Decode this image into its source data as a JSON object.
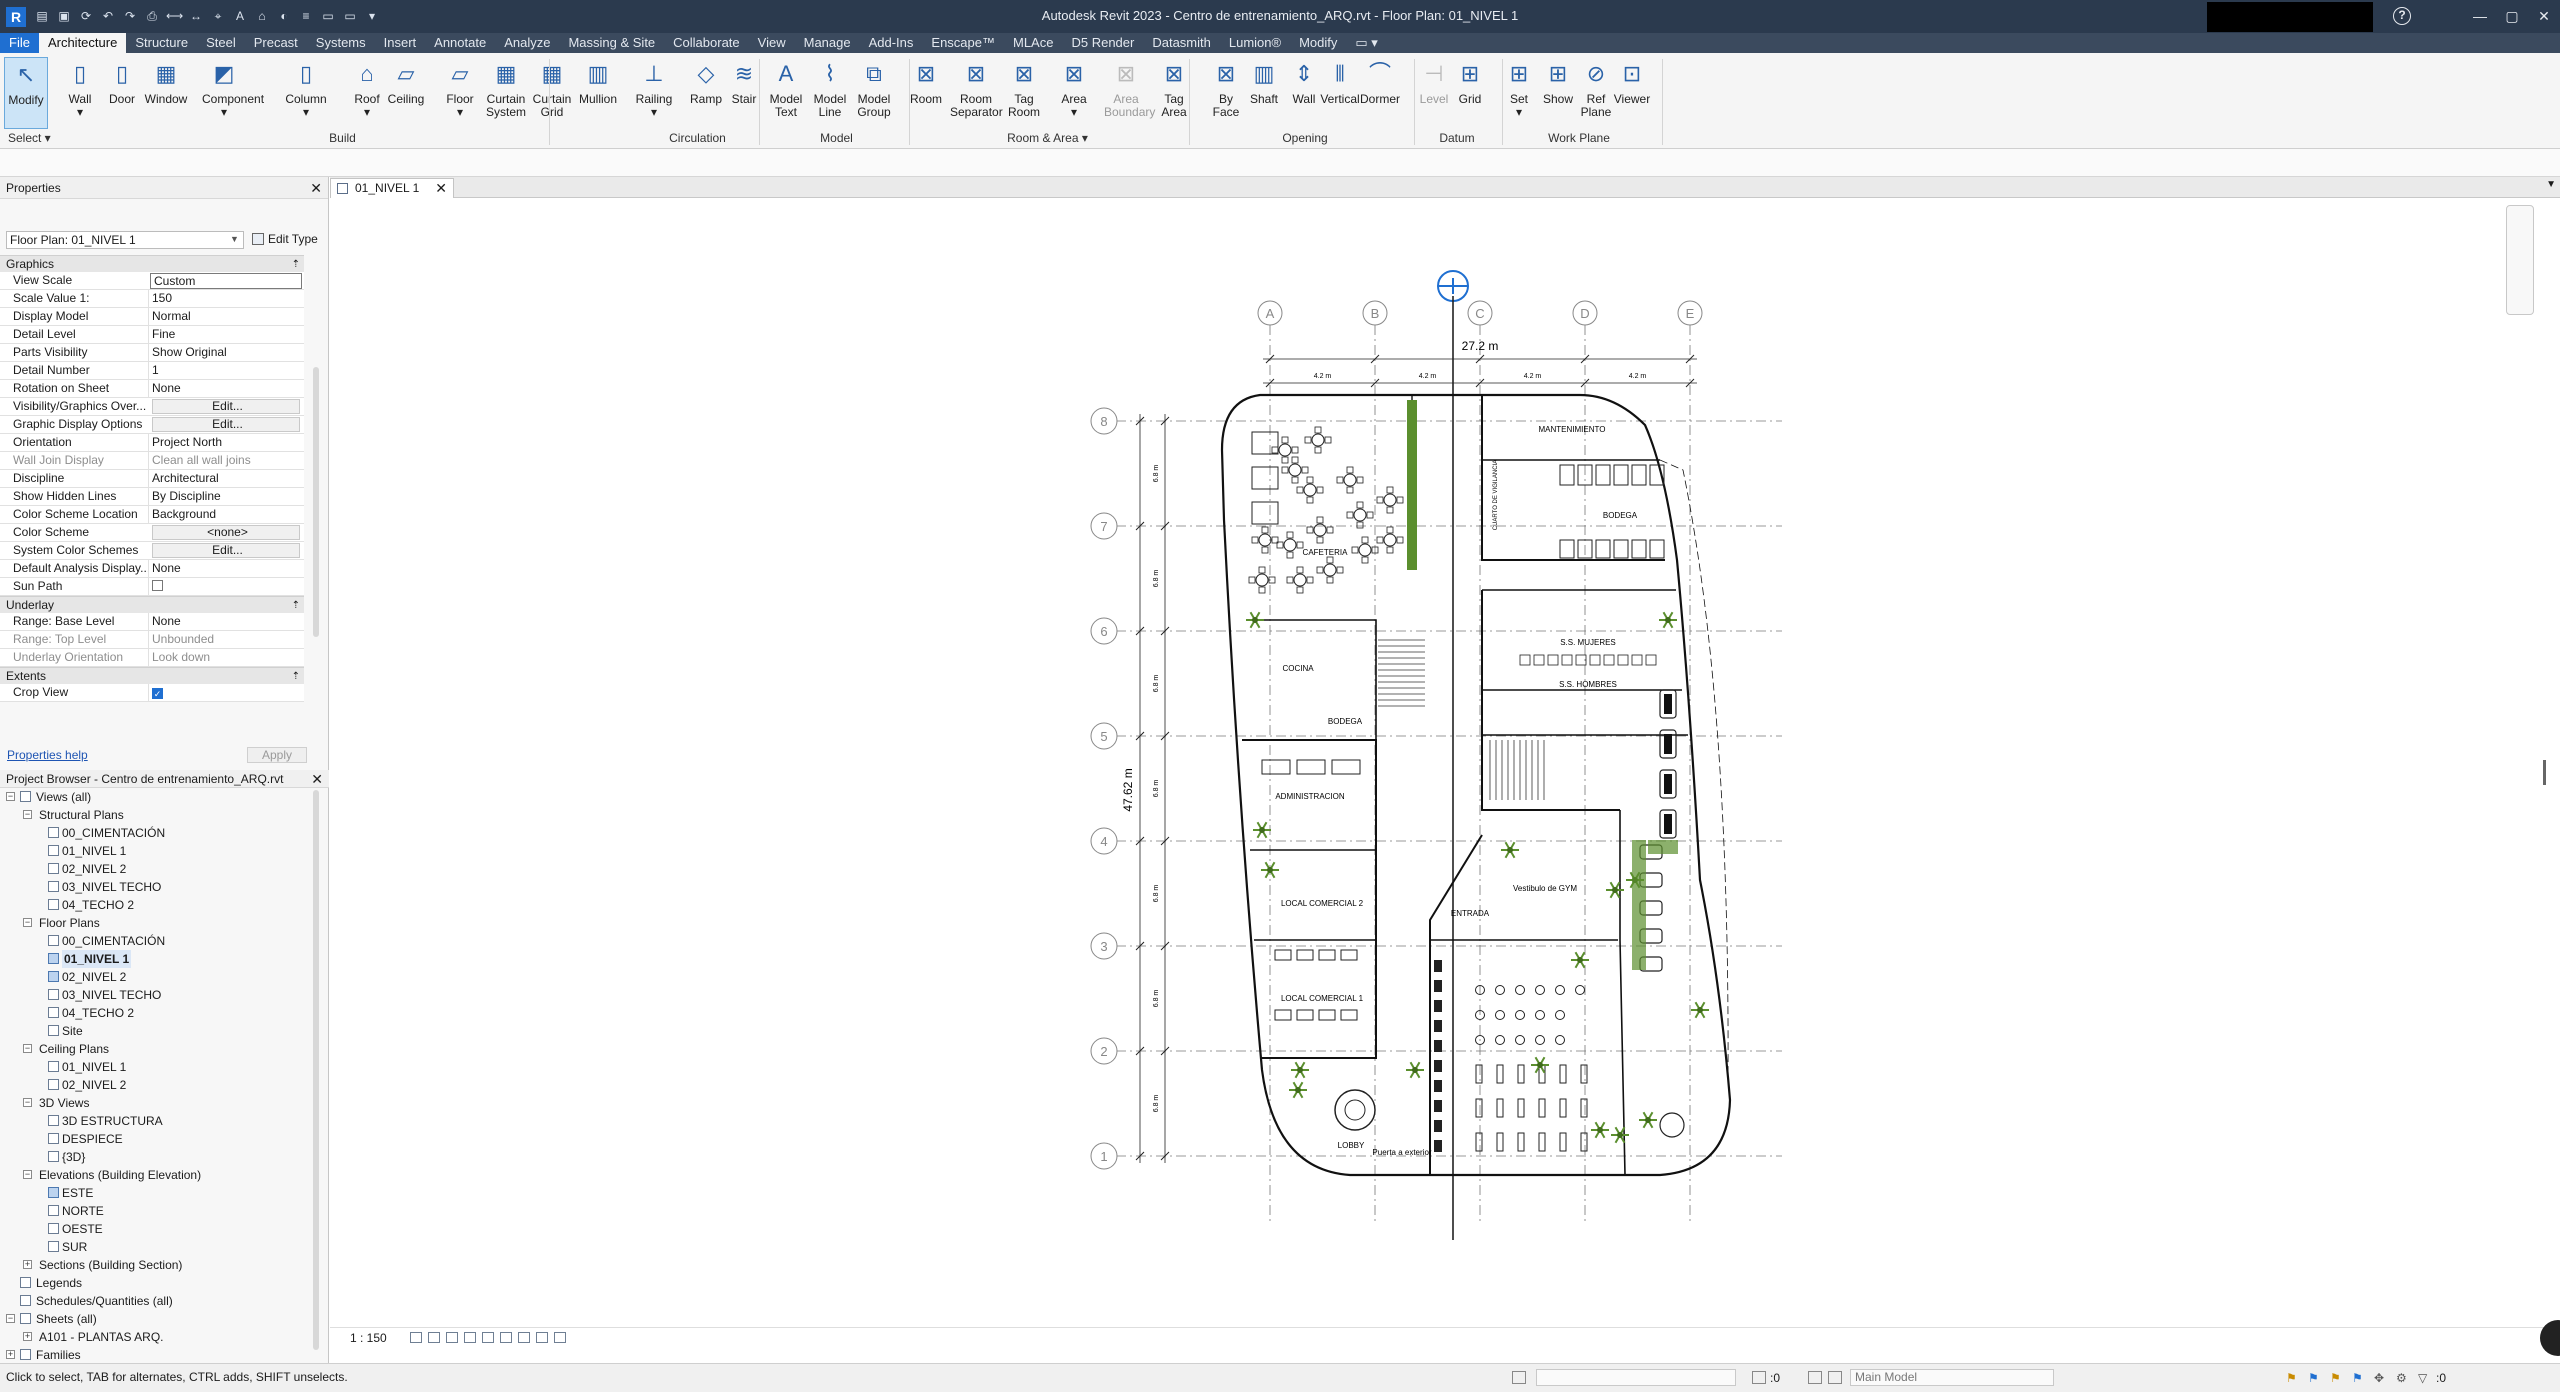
{
  "window": {
    "title": "Autodesk Revit 2023 - Centro de entrenamiento_ARQ.rvt - Floor Plan: 01_NIVEL 1",
    "app_icon": "R",
    "help": "?",
    "min": "—",
    "max": "▢",
    "close": "✕"
  },
  "tabs": [
    {
      "label": "File"
    },
    {
      "label": "Architecture"
    },
    {
      "label": "Structure"
    },
    {
      "label": "Steel"
    },
    {
      "label": "Precast"
    },
    {
      "label": "Systems"
    },
    {
      "label": "Insert"
    },
    {
      "label": "Annotate"
    },
    {
      "label": "Analyze"
    },
    {
      "label": "Massing & Site"
    },
    {
      "label": "Collaborate"
    },
    {
      "label": "View"
    },
    {
      "label": "Manage"
    },
    {
      "label": "Add-Ins"
    },
    {
      "label": "Enscape™"
    },
    {
      "label": "MLAce"
    },
    {
      "label": "D5 Render"
    },
    {
      "label": "Datasmith"
    },
    {
      "label": "Lumion®"
    },
    {
      "label": "Modify"
    },
    {
      "label": "▭ ▾"
    }
  ],
  "ribbon": {
    "select_label": "Select ▾",
    "panels": [
      "Build",
      "Circulation",
      "Model",
      "Room & Area ▾",
      "Opening",
      "Datum",
      "Work Plane"
    ],
    "buttons": [
      {
        "l1": "Modify",
        "l2": ""
      },
      {
        "l1": "Wall",
        "l2": "▾"
      },
      {
        "l1": "Door",
        "l2": ""
      },
      {
        "l1": "Window",
        "l2": ""
      },
      {
        "l1": "Component",
        "l2": "▾"
      },
      {
        "l1": "Column",
        "l2": "▾"
      },
      {
        "l1": "Roof",
        "l2": "▾"
      },
      {
        "l1": "Ceiling",
        "l2": ""
      },
      {
        "l1": "Floor",
        "l2": "▾"
      },
      {
        "l1": "Curtain",
        "l2": "System"
      },
      {
        "l1": "Curtain",
        "l2": "Grid"
      },
      {
        "l1": "Mullion",
        "l2": ""
      },
      {
        "l1": "Railing",
        "l2": "▾"
      },
      {
        "l1": "Ramp",
        "l2": ""
      },
      {
        "l1": "Stair",
        "l2": ""
      },
      {
        "l1": "Model",
        "l2": "Text"
      },
      {
        "l1": "Model",
        "l2": "Line"
      },
      {
        "l1": "Model",
        "l2": "Group"
      },
      {
        "l1": "Room",
        "l2": ""
      },
      {
        "l1": "Room",
        "l2": "Separator"
      },
      {
        "l1": "Tag",
        "l2": "Room"
      },
      {
        "l1": "Area",
        "l2": "▾"
      },
      {
        "l1": "Area",
        "l2": "Boundary"
      },
      {
        "l1": "Tag",
        "l2": "Area"
      },
      {
        "l1": "By",
        "l2": "Face"
      },
      {
        "l1": "Shaft",
        "l2": ""
      },
      {
        "l1": "Wall",
        "l2": ""
      },
      {
        "l1": "Vertical",
        "l2": ""
      },
      {
        "l1": "Dormer",
        "l2": ""
      },
      {
        "l1": "Level",
        "l2": ""
      },
      {
        "l1": "Grid",
        "l2": ""
      },
      {
        "l1": "Set",
        "l2": "▾"
      },
      {
        "l1": "Show",
        "l2": ""
      },
      {
        "l1": "Ref",
        "l2": "Plane"
      },
      {
        "l1": "Viewer",
        "l2": ""
      }
    ]
  },
  "properties": {
    "title": "Properties",
    "close": "✕",
    "type_selector": "Floor Plan: 01_NIVEL 1",
    "edit_type": "Edit Type",
    "groups": [
      {
        "name": "Graphics",
        "rows": [
          [
            "View Scale",
            "Custom"
          ],
          [
            "Scale Value    1:",
            "150"
          ],
          [
            "Display Model",
            "Normal"
          ],
          [
            "Detail Level",
            "Fine"
          ],
          [
            "Parts Visibility",
            "Show Original"
          ],
          [
            "Detail Number",
            "1"
          ],
          [
            "Rotation on Sheet",
            "None"
          ],
          [
            "Visibility/Graphics Over...",
            "Edit..."
          ],
          [
            "Graphic Display Options",
            "Edit..."
          ],
          [
            "Orientation",
            "Project North"
          ],
          [
            "Wall Join Display",
            "Clean all wall joins"
          ],
          [
            "Discipline",
            "Architectural"
          ],
          [
            "Show Hidden Lines",
            "By Discipline"
          ],
          [
            "Color Scheme Location",
            "Background"
          ],
          [
            "Color Scheme",
            "<none>"
          ],
          [
            "System Color Schemes",
            "Edit..."
          ],
          [
            "Default Analysis Display...",
            "None"
          ],
          [
            "Sun Path",
            ""
          ]
        ]
      },
      {
        "name": "Underlay",
        "rows": [
          [
            "Range: Base Level",
            "None"
          ],
          [
            "Range: Top Level",
            "Unbounded"
          ],
          [
            "Underlay Orientation",
            "Look down"
          ]
        ]
      },
      {
        "name": "Extents",
        "rows": [
          [
            "Crop View",
            ""
          ]
        ]
      }
    ],
    "help_link": "Properties help",
    "apply": "Apply"
  },
  "browser": {
    "title": "Project Browser - Centro de entrenamiento_ARQ.rvt",
    "close": "✕",
    "nodes": [
      {
        "label": "Views (all)",
        "level": 0,
        "toggle": "−"
      },
      {
        "label": "Structural Plans",
        "level": 1,
        "toggle": "−"
      },
      {
        "label": "00_CIMENTACIÓN",
        "level": 2
      },
      {
        "label": "01_NIVEL 1",
        "level": 2
      },
      {
        "label": "02_NIVEL 2",
        "level": 2
      },
      {
        "label": "03_NIVEL TECHO",
        "level": 2
      },
      {
        "label": "04_TECHO 2",
        "level": 2
      },
      {
        "label": "Floor Plans",
        "level": 1,
        "toggle": "−"
      },
      {
        "label": "00_CIMENTACIÓN",
        "level": 2
      },
      {
        "label": "01_NIVEL 1",
        "level": 2,
        "bold": true
      },
      {
        "label": "02_NIVEL 2",
        "level": 2,
        "blue": true
      },
      {
        "label": "03_NIVEL TECHO",
        "level": 2
      },
      {
        "label": "04_TECHO 2",
        "level": 2
      },
      {
        "label": "Site",
        "level": 2
      },
      {
        "label": "Ceiling Plans",
        "level": 1,
        "toggle": "−"
      },
      {
        "label": "01_NIVEL 1",
        "level": 2
      },
      {
        "label": "02_NIVEL 2",
        "level": 2
      },
      {
        "label": "3D Views",
        "level": 1,
        "toggle": "−"
      },
      {
        "label": "3D ESTRUCTURA",
        "level": 2
      },
      {
        "label": "DESPIECE",
        "level": 2
      },
      {
        "label": "{3D}",
        "level": 2
      },
      {
        "label": "Elevations (Building Elevation)",
        "level": 1,
        "toggle": "−"
      },
      {
        "label": "ESTE",
        "level": 2,
        "blue": true
      },
      {
        "label": "NORTE",
        "level": 2
      },
      {
        "label": "OESTE",
        "level": 2
      },
      {
        "label": "SUR",
        "level": 2
      },
      {
        "label": "Sections (Building Section)",
        "level": 1,
        "toggle": "+"
      },
      {
        "label": "Legends",
        "level": 0,
        "icon": true
      },
      {
        "label": "Schedules/Quantities (all)",
        "level": 0,
        "icon": true
      },
      {
        "label": "Sheets (all)",
        "level": 0,
        "toggle": "−",
        "icon": true
      },
      {
        "label": "A101 - PLANTAS ARQ.",
        "level": 1,
        "toggle": "+"
      },
      {
        "label": "Families",
        "level": 0,
        "toggle": "+"
      }
    ]
  },
  "doc_tab": {
    "label": "01_NIVEL 1",
    "close": "✕"
  },
  "plan": {
    "grid_cols": [
      "A",
      "B",
      "C",
      "D",
      "E"
    ],
    "grid_rows": [
      "8",
      "7",
      "6",
      "5",
      "4",
      "3",
      "2",
      "1"
    ],
    "overall_width": "27.2 m",
    "overall_height": "47.62 m",
    "bay_dim": "4.2 m",
    "row_dim": "6.8 m",
    "rooms": [
      "MANTENIMIENTO",
      "BODEGA",
      "CUARTO DE VIGILANCIA",
      "CAFETERIA",
      "S.S. MUJERES",
      "S.S. HOMBRES",
      "COCINA",
      "BODEGA",
      "ADMINISTRACION",
      "Vestibulo de GYM",
      "ENTRADA",
      "LOCAL COMERCIAL 2",
      "LOCAL COMERCIAL 1",
      "LOBBY",
      "Puerta a exterior"
    ]
  },
  "view_bar": {
    "scale": "1 : 150"
  },
  "status": {
    "message": "Click to select, TAB for alternates, CTRL adds, SHIFT unselects.",
    "main_model": "Main Model",
    "zero1": ":0",
    "zero2": ":0"
  },
  "colors": {
    "accent": "#1f6fd1",
    "titlebar": "#2b3a4e",
    "ribbon": "#f5f5f5",
    "plant": "#5b8f2e"
  }
}
